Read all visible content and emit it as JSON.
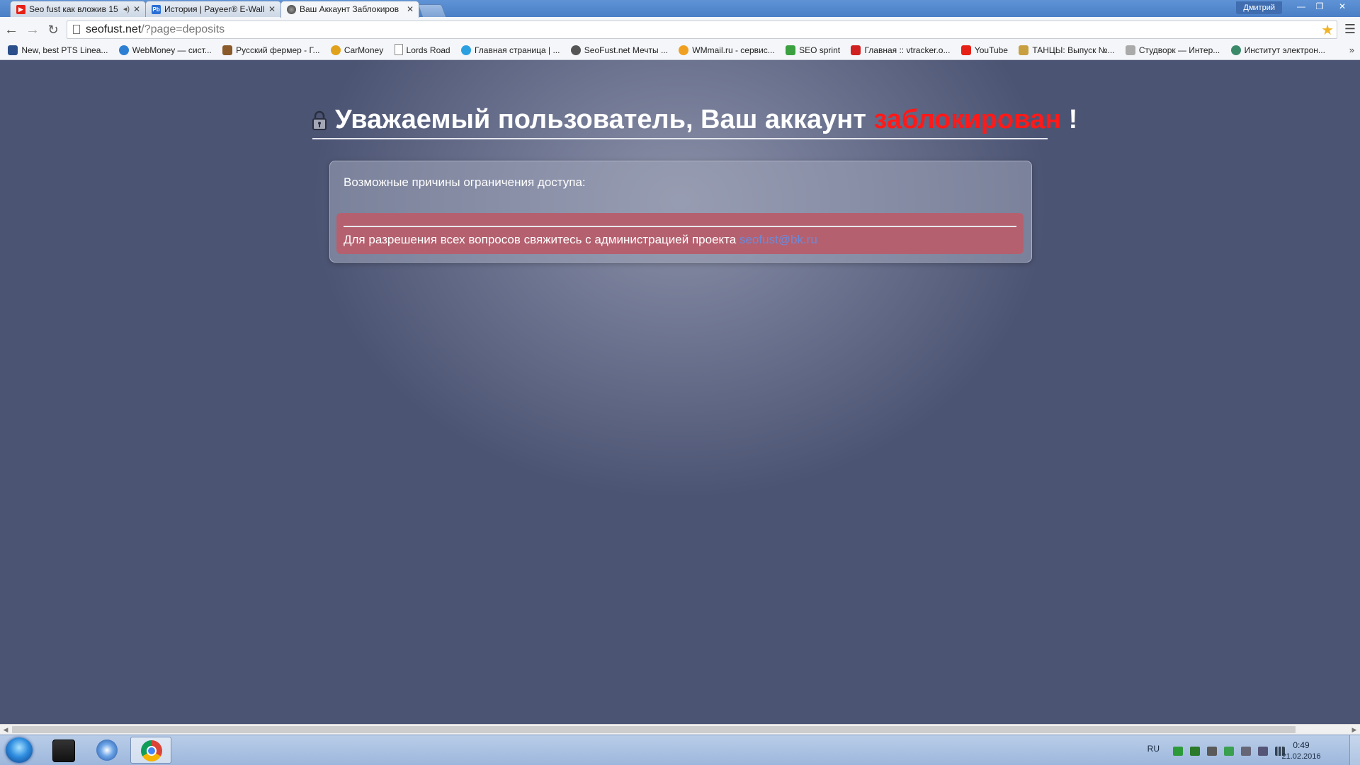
{
  "browser": {
    "tabs": [
      {
        "title": "Seo fust как вложив 15",
        "active": false,
        "favicon_color": "#e62117"
      },
      {
        "title": "История | Payeer® E-Wall",
        "active": false,
        "favicon_color": "#2a6fd6"
      },
      {
        "title": "Ваш Аккаунт Заблокиров",
        "active": true,
        "favicon_color": "#444444"
      }
    ],
    "tab_favicon_text": [
      "▶",
      "Pb",
      ""
    ],
    "profile_name": "Дмитрий",
    "url_host": "seofust.net",
    "url_path": "/?page=deposits",
    "bookmarks": [
      {
        "label": "New, best PTS Linea...",
        "color": "#2b4f8a"
      },
      {
        "label": "WebMoney — сист...",
        "color": "#2d7fd3"
      },
      {
        "label": "Русский фермер - Г...",
        "color": "#8a5a2b"
      },
      {
        "label": "CarMoney",
        "color": "#e1a21b"
      },
      {
        "label": "Lords Road",
        "color": "#ffffff"
      },
      {
        "label": "Главная страница | ...",
        "color": "#2aa0e0"
      },
      {
        "label": "SeoFust.net Мечты ...",
        "color": "#555555"
      },
      {
        "label": "WMmail.ru - сервис...",
        "color": "#f0a020"
      },
      {
        "label": "SEO sprint",
        "color": "#3aa040"
      },
      {
        "label": "Главная :: vtracker.o...",
        "color": "#d02020"
      },
      {
        "label": "YouTube",
        "color": "#e62117"
      },
      {
        "label": "ТАНЦЫ: Выпуск №...",
        "color": "#c8a040"
      },
      {
        "label": "Студворк — Интер...",
        "color": "#aaaaaa"
      },
      {
        "label": "Институт электрон...",
        "color": "#3a8a6a"
      }
    ]
  },
  "page": {
    "heading_prefix": "Уважаемый пользователь, Ваш аккаунт ",
    "heading_status": "заблокирован",
    "heading_suffix": " !",
    "panel_title": "Возможные причины ограничения доступа:",
    "alert_text": "Для разрешения всех вопросов свяжитесь с администрацией проекта ",
    "contact_email": "seofust@bk.ru",
    "status_color": "#ff1a1a"
  },
  "taskbar": {
    "language": "RU",
    "clock_time": "0:49",
    "clock_date": "21.02.2016"
  }
}
